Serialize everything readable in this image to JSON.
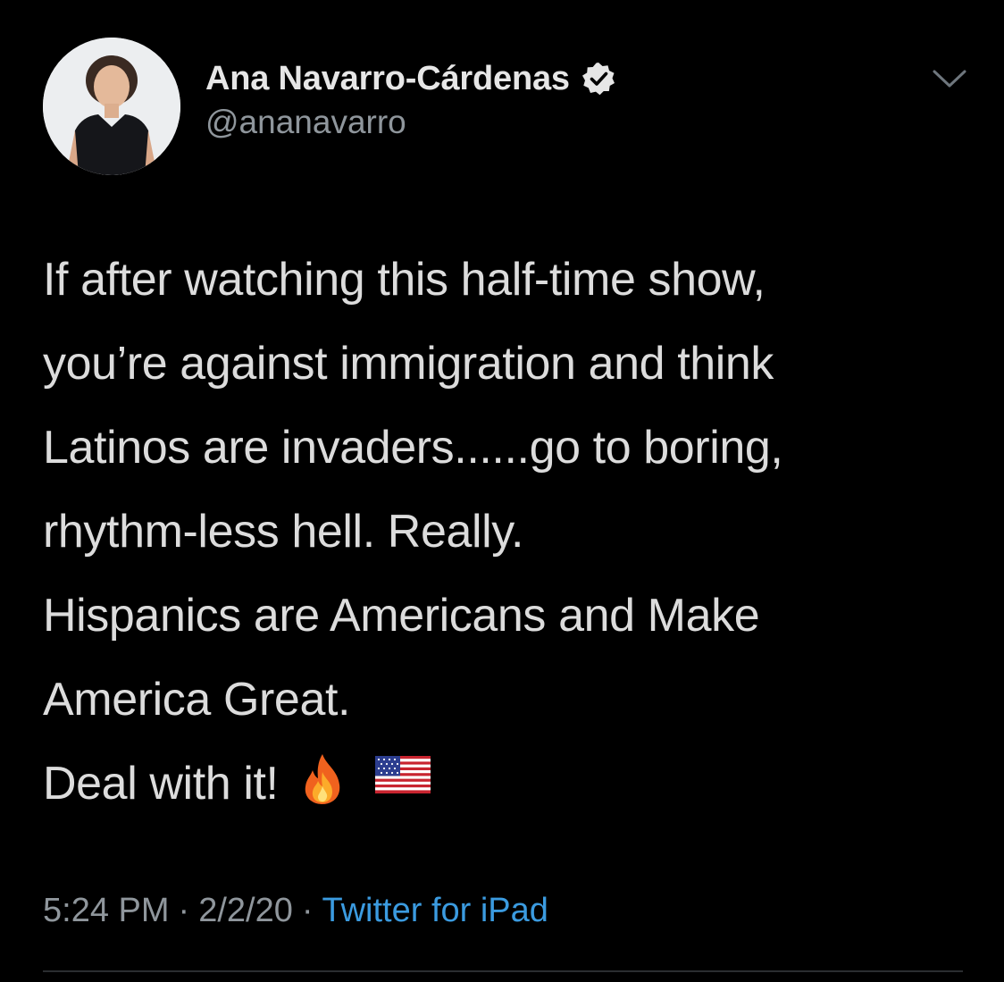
{
  "tweet": {
    "author": {
      "display_name": "Ana Navarro-Cárdenas",
      "handle": "@ananavarro",
      "verified_icon": "verified-badge-icon"
    },
    "menu_icon": "chevron-down-icon",
    "body": {
      "paragraph_1": [
        "If after watching this half-time show,",
        "you’re against immigration and think",
        "Latinos are invaders......go to boring,",
        "rhythm-less hell. Really."
      ],
      "paragraph_2": [
        "Hispanics are Americans and Make",
        "America Great.",
        "Deal with it!"
      ],
      "emojis": [
        "fire-emoji",
        "us-flag-emoji"
      ]
    },
    "meta": {
      "time": "5:24 PM",
      "separator": "·",
      "date": "2/2/20",
      "source": "Twitter for iPad"
    }
  },
  "colors": {
    "background": "#000000",
    "text": "#dcdcdc",
    "secondary_text": "#8f969c",
    "link": "#3b9be0"
  }
}
